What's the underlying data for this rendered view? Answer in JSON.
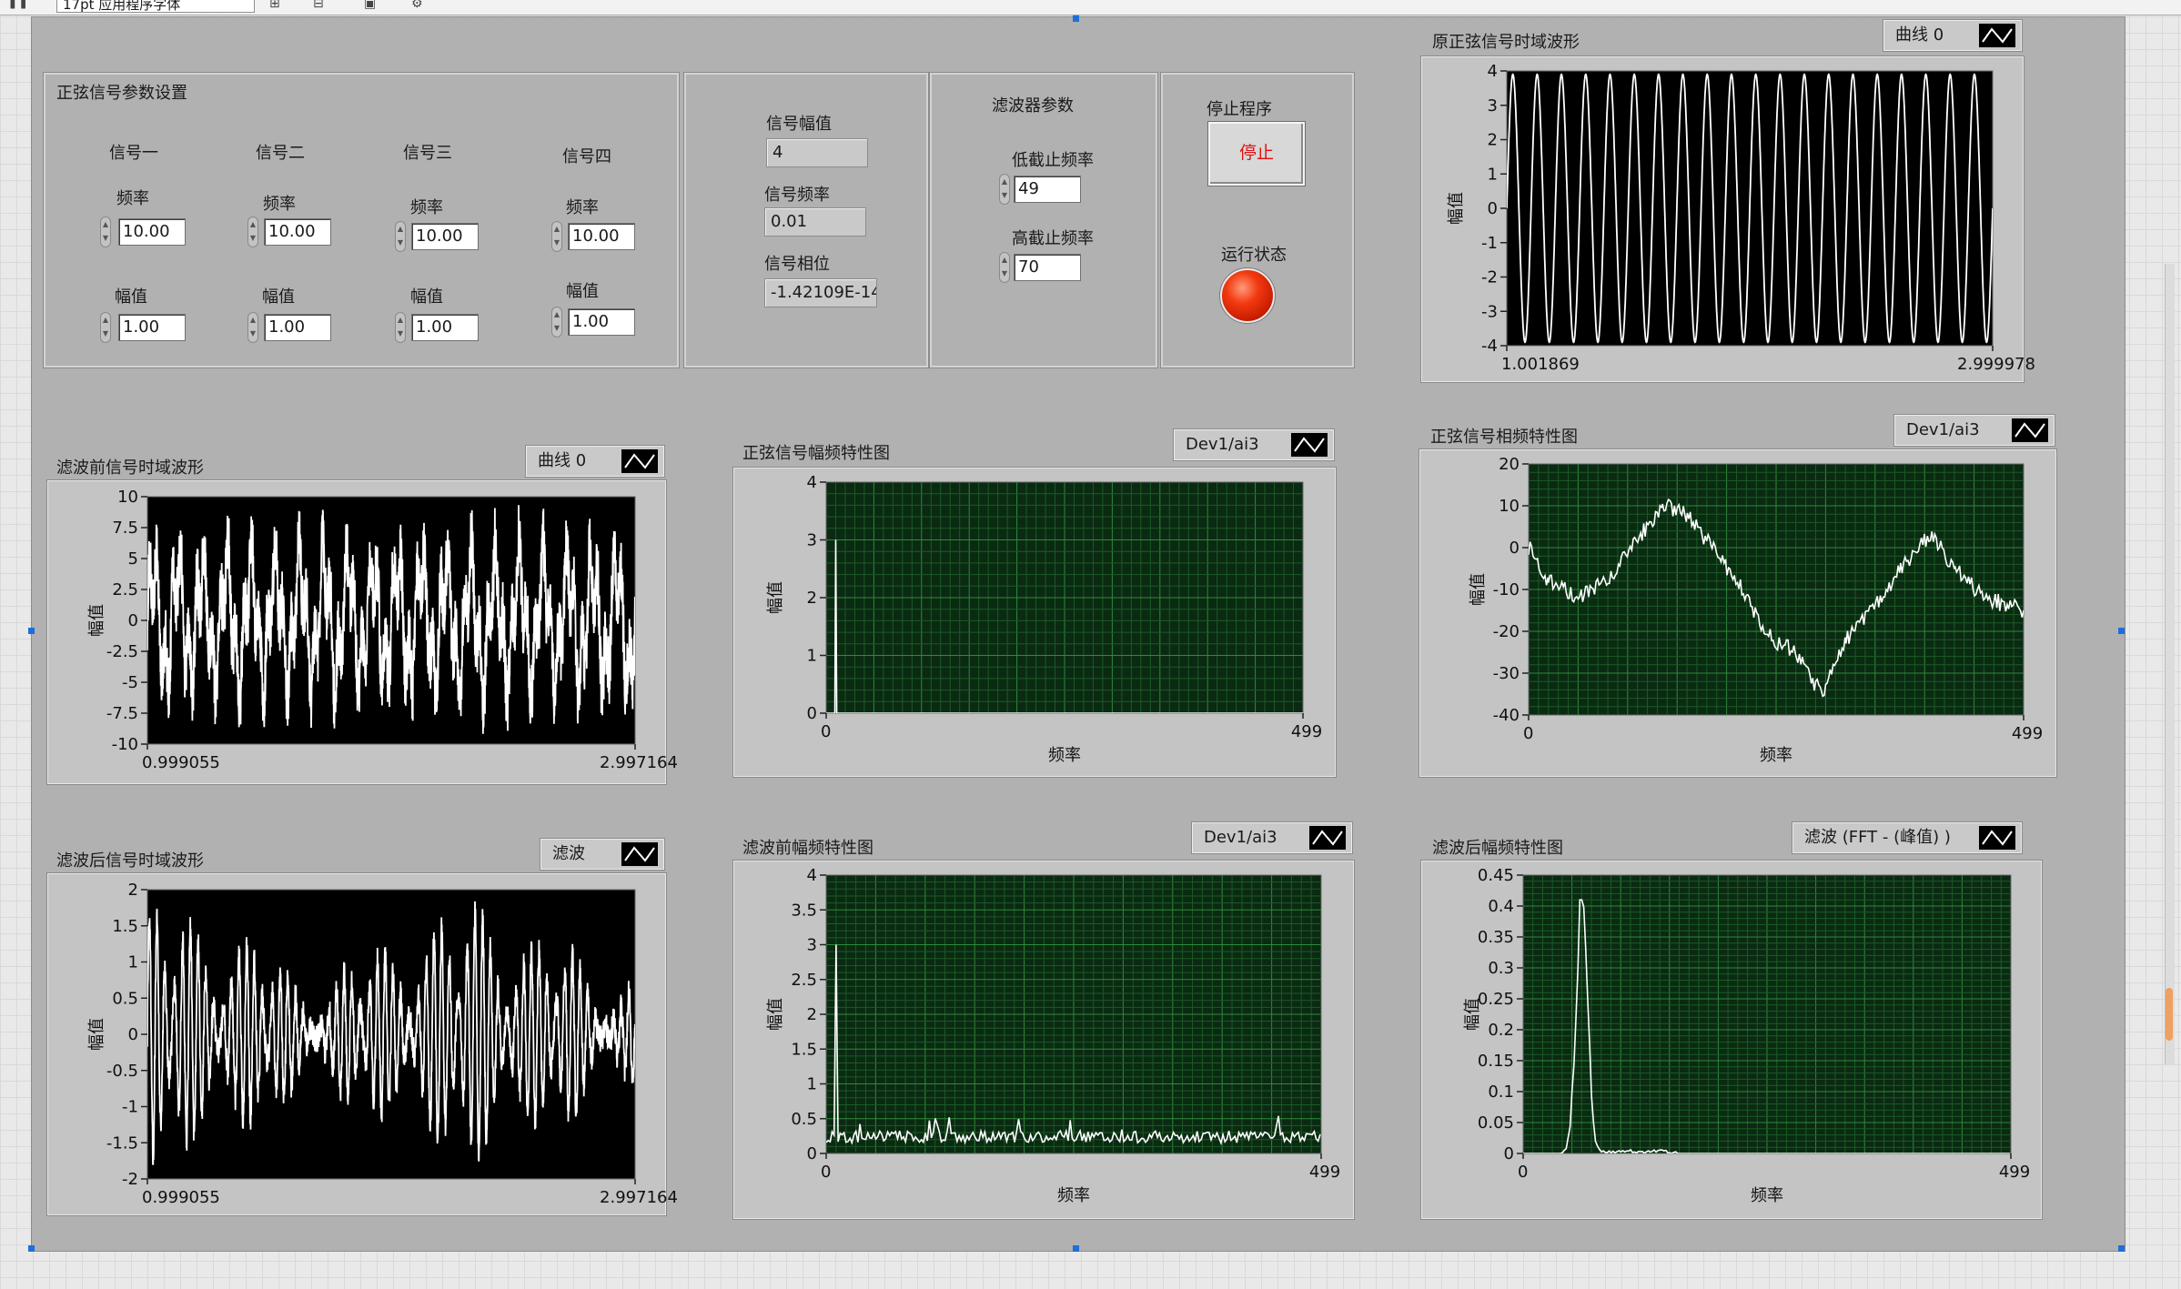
{
  "toolbar": {
    "font_label": "17pt 应用程序字体"
  },
  "params": {
    "group_title": "正弦信号参数设置",
    "freq_label": "频率",
    "amp_label": "幅值",
    "signals": [
      {
        "name": "信号一",
        "freq": "10.00",
        "amp": "1.00"
      },
      {
        "name": "信号二",
        "freq": "10.00",
        "amp": "1.00"
      },
      {
        "name": "信号三",
        "freq": "10.00",
        "amp": "1.00"
      },
      {
        "name": "信号四",
        "freq": "10.00",
        "amp": "1.00"
      }
    ]
  },
  "info": {
    "amp_label": "信号幅值",
    "amp_value": "4",
    "freq_label": "信号频率",
    "freq_value": "0.01",
    "phase_label": "信号相位",
    "phase_value": "-1.42109E-14"
  },
  "filter": {
    "title": "滤波器参数",
    "low_label": "低截止频率",
    "low_value": "49",
    "high_label": "高截止频率",
    "high_value": "70"
  },
  "control": {
    "stop_title": "停止程序",
    "stop_label": "停止",
    "run_status_label": "运行状态",
    "run_status_color": "#e8320f"
  },
  "chart_data": [
    {
      "id": "orig",
      "type": "line",
      "title": "原正弦信号时域波形",
      "legend": "曲线 0",
      "xlabel": "",
      "ylabel": "幅值",
      "xlim": [
        1.001869,
        2.999978
      ],
      "x_tick_labels": [
        "1.001869",
        "2.999978"
      ],
      "ylim": [
        -4,
        4
      ],
      "y_ticks": [
        4,
        3,
        2,
        1,
        0,
        -1,
        -2,
        -3,
        -4
      ],
      "series": [
        {
          "kind": "sine",
          "amplitude": 3.9,
          "cycles": 20
        }
      ],
      "plot_bg": "#000000",
      "grid": false
    },
    {
      "id": "pre_time",
      "type": "line",
      "title": "滤波前信号时域波形",
      "legend": "曲线 0",
      "xlabel": "",
      "ylabel": "幅值",
      "xlim": [
        0.999055,
        2.997164
      ],
      "x_tick_labels": [
        "0.999055",
        "2.997164"
      ],
      "ylim": [
        -10,
        10
      ],
      "y_ticks": [
        10,
        7.5,
        5,
        2.5,
        0,
        -2.5,
        -5,
        -7.5,
        -10
      ],
      "series": [
        {
          "kind": "noisy_sum",
          "amplitude": 7.5,
          "cycles": 20
        }
      ],
      "plot_bg": "#000000",
      "grid": false
    },
    {
      "id": "post_time",
      "type": "line",
      "title": "滤波后信号时域波形",
      "legend": "滤波",
      "xlabel": "",
      "ylabel": "幅值",
      "xlim": [
        0.999055,
        2.997164
      ],
      "x_tick_labels": [
        "0.999055",
        "2.997164"
      ],
      "ylim": [
        -2,
        2
      ],
      "y_ticks": [
        2,
        1.5,
        1,
        0.5,
        0,
        -0.5,
        -1,
        -1.5,
        -2
      ],
      "series": [
        {
          "kind": "bandpass",
          "amplitude": 1.3,
          "cycles": 60
        }
      ],
      "plot_bg": "#000000",
      "grid": false
    },
    {
      "id": "sig_amp",
      "type": "line",
      "title": "正弦信号幅频特性图",
      "legend": "Dev1/ai3",
      "xlabel": "频率",
      "ylabel": "幅值",
      "xlim": [
        0,
        499
      ],
      "x_tick_labels": [
        "0",
        "499"
      ],
      "ylim": [
        0,
        4
      ],
      "y_ticks": [
        4,
        3,
        2,
        1,
        0
      ],
      "series": [
        {
          "kind": "spike",
          "peak_x": 10,
          "peak_y": 3.0
        }
      ],
      "plot_bg": "#0a2a12",
      "grid": true
    },
    {
      "id": "sig_phase",
      "type": "line",
      "title": "正弦信号相频特性图",
      "legend": "Dev1/ai3",
      "xlabel": "频率",
      "ylabel": "幅值",
      "xlim": [
        0,
        499
      ],
      "x_tick_labels": [
        "0",
        "499"
      ],
      "ylim": [
        -40,
        20
      ],
      "y_ticks": [
        20,
        10,
        0,
        -10,
        -20,
        -30,
        -40
      ],
      "series": [
        {
          "kind": "path",
          "points": [
            [
              0,
              0
            ],
            [
              20,
              -8
            ],
            [
              50,
              -12
            ],
            [
              80,
              -8
            ],
            [
              110,
              2
            ],
            [
              135,
              10
            ],
            [
              160,
              8
            ],
            [
              185,
              0
            ],
            [
              215,
              -10
            ],
            [
              245,
              -22
            ],
            [
              270,
              -25
            ],
            [
              295,
              -35
            ],
            [
              320,
              -22
            ],
            [
              350,
              -14
            ],
            [
              375,
              -5
            ],
            [
              405,
              3
            ],
            [
              430,
              -5
            ],
            [
              460,
              -12
            ],
            [
              499,
              -15
            ]
          ]
        }
      ],
      "plot_bg": "#0a2a12",
      "grid": true
    },
    {
      "id": "pre_amp",
      "type": "line",
      "title": "滤波前幅频特性图",
      "legend": "Dev1/ai3",
      "xlabel": "频率",
      "ylabel": "幅值",
      "xlim": [
        0,
        499
      ],
      "x_tick_labels": [
        "0",
        "499"
      ],
      "ylim": [
        0,
        4
      ],
      "y_ticks": [
        4,
        3.5,
        3,
        2.5,
        2,
        1.5,
        1,
        0.5,
        0
      ],
      "series": [
        {
          "kind": "spike_noise",
          "peak_x": 10,
          "peak_y": 3.0,
          "noise": 0.25
        }
      ],
      "plot_bg": "#0a2a12",
      "grid": true
    },
    {
      "id": "post_amp",
      "type": "line",
      "title": "滤波后幅频特性图",
      "legend": "滤波 (FFT - (峰值) )",
      "xlabel": "频率",
      "ylabel": "幅值",
      "xlim": [
        0,
        499
      ],
      "x_tick_labels": [
        "0",
        "499"
      ],
      "ylim": [
        0,
        0.45
      ],
      "y_ticks": [
        0.45,
        0.4,
        0.35,
        0.3,
        0.25,
        0.2,
        0.15,
        0.1,
        0.05,
        0
      ],
      "series": [
        {
          "kind": "band_peak",
          "center_x": 60,
          "width_x": 12,
          "peak_y": 0.41
        }
      ],
      "plot_bg": "#0a2a12",
      "grid": true
    }
  ]
}
